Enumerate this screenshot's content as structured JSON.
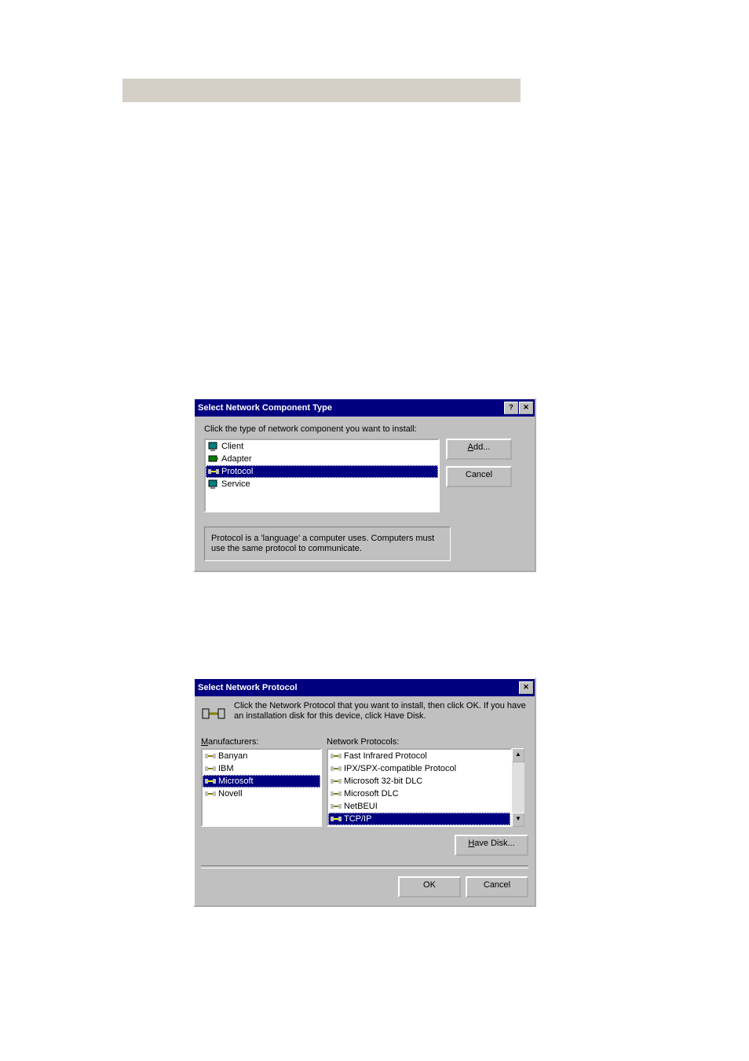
{
  "dialog1": {
    "title": "Select Network Component Type",
    "instruction": "Click the type of network component you want to install:",
    "items": {
      "client": "Client",
      "adapter": "Adapter",
      "protocol": "Protocol",
      "service": "Service"
    },
    "selected": "protocol",
    "buttons": {
      "add_u": "A",
      "add_rest": "dd...",
      "cancel": "Cancel"
    },
    "description": "Protocol is a 'language' a computer uses. Computers must use the same protocol to communicate."
  },
  "dialog2": {
    "title": "Select Network Protocol",
    "instruction": "Click the Network Protocol that you want to install, then click OK. If you have an installation disk for this device, click Have Disk.",
    "manufacturers_label_u": "M",
    "manufacturers_label_rest": "anufacturers:",
    "protocols_label": "Network Protocols:",
    "manufacturers": {
      "banyan": "Banyan",
      "ibm": "IBM",
      "microsoft": "Microsoft",
      "novell": "Novell"
    },
    "selected_manufacturer": "microsoft",
    "protocols": {
      "fast_ir": "Fast Infrared Protocol",
      "ipx": "IPX/SPX-compatible Protocol",
      "ms32dlc": "Microsoft 32-bit DLC",
      "msdlc": "Microsoft DLC",
      "netbeui": "NetBEUI",
      "tcpip": "TCP/IP"
    },
    "selected_protocol": "tcpip",
    "buttons": {
      "have_disk_u": "H",
      "have_disk_rest": "ave Disk...",
      "ok": "OK",
      "cancel": "Cancel"
    }
  }
}
